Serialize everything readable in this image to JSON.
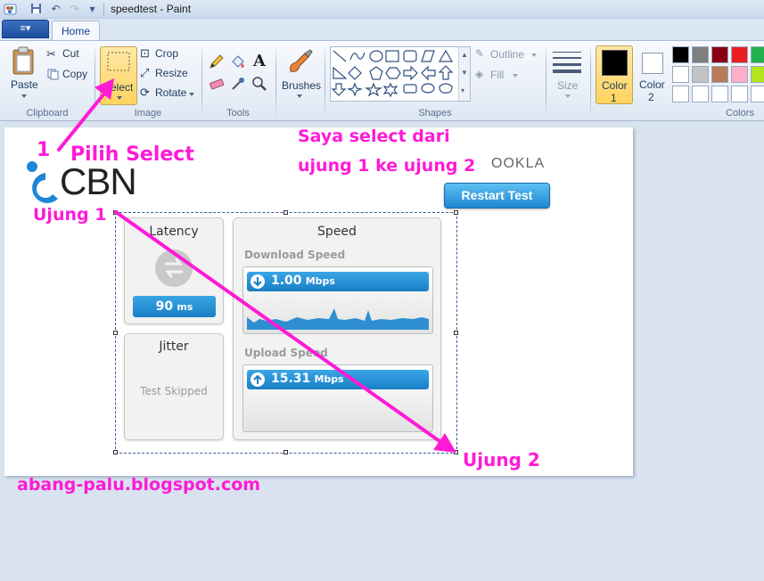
{
  "window": {
    "title": "speedtest - Paint"
  },
  "tabs": {
    "app_menu": "≡▾",
    "home": "Home"
  },
  "ribbon": {
    "clipboard": {
      "paste": "Paste",
      "cut": "Cut",
      "copy": "Copy",
      "group": "Clipboard"
    },
    "image": {
      "select": "Select",
      "crop": "Crop",
      "resize": "Resize",
      "rotate": "Rotate",
      "group": "Image"
    },
    "tools": {
      "group": "Tools"
    },
    "brushes": {
      "label": "Brushes"
    },
    "shapes": {
      "outline": "Outline",
      "fill": "Fill",
      "group": "Shapes"
    },
    "size": {
      "label": "Size"
    },
    "colors": {
      "color1_label": "Color",
      "color1_num": "1",
      "color2_label": "Color",
      "color2_num": "2",
      "group": "Colors",
      "color1_value": "#000000",
      "color2_value": "#ffffff",
      "palette": [
        "#000000",
        "#7f7f7f",
        "#880015",
        "#ed1c24",
        "#ffffff",
        "#c3c3c3",
        "#b97a57",
        "#ffaec9",
        "#ffffff",
        "#ffffff",
        "#ffffff",
        "#ffffff"
      ]
    }
  },
  "speedtest": {
    "brand": "CBN",
    "ookla": "OOKLA",
    "restart": "Restart Test",
    "latency": {
      "title": "Latency",
      "value": "90",
      "unit": "ms"
    },
    "jitter": {
      "title": "Jitter",
      "status": "Test Skipped"
    },
    "speed": {
      "title": "Speed",
      "download_label": "Download Speed",
      "download_value": "1.00",
      "upload_label": "Upload Speed",
      "upload_value": "15.31",
      "unit": "Mbps"
    }
  },
  "annotations": {
    "step_num": "1",
    "pilih_select": "Pilih Select",
    "saya_select_line1": "Saya select dari",
    "saya_select_line2": "ujung 1 ke ujung 2",
    "ujung1": "Ujung 1",
    "ujung2": "Ujung 2",
    "blog": "abang-palu.blogspot.com",
    "annotation_color": "#ff1ad6"
  }
}
